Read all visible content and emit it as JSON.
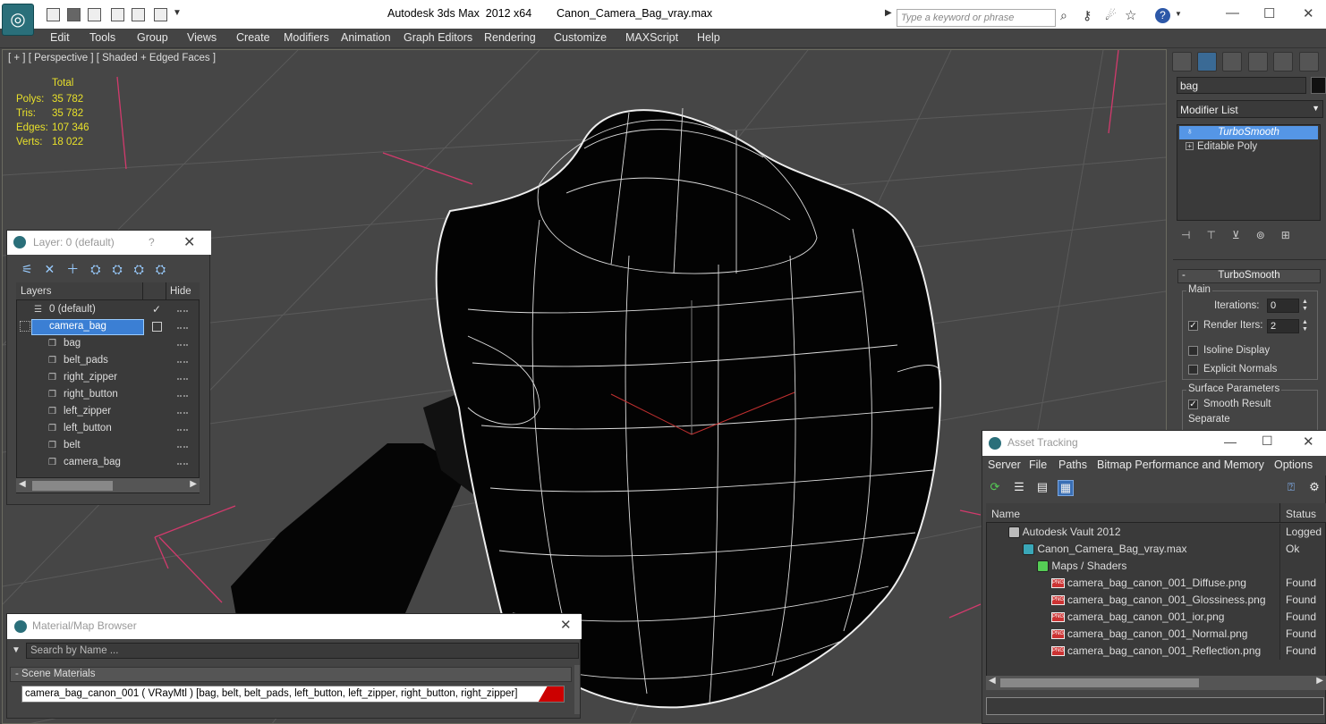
{
  "window": {
    "app_title": "Autodesk 3ds Max  2012 x64",
    "file_name": "Canon_Camera_Bag_vray.max",
    "search_placeholder": "Type a keyword or phrase"
  },
  "menu": [
    "Edit",
    "Tools",
    "Group",
    "Views",
    "Create",
    "Modifiers",
    "Animation",
    "Graph Editors",
    "Rendering",
    "Customize",
    "MAXScript",
    "Help"
  ],
  "viewport": {
    "label": "[ + ] [ Perspective ] [ Shaded + Edged Faces ]",
    "stats_header": "Total",
    "stats": [
      {
        "label": "Polys:",
        "value": "35 782"
      },
      {
        "label": "Tris:",
        "value": "35 782"
      },
      {
        "label": "Edges:",
        "value": "107 346"
      },
      {
        "label": "Verts:",
        "value": "18 022"
      }
    ]
  },
  "command_panel": {
    "object_name": "bag",
    "modifier_list": "Modifier List",
    "stack": [
      "TurboSmooth",
      "Editable Poly"
    ],
    "rollout_title": "TurboSmooth",
    "main_group": "Main",
    "iterations_label": "Iterations:",
    "iterations_value": "0",
    "render_iters_label": "Render Iters:",
    "render_iters_value": "2",
    "isoline_label": "Isoline Display",
    "explicit_normals_label": "Explicit Normals",
    "surface_group": "Surface Parameters",
    "smooth_result_label": "Smooth Result",
    "separate_label": "Separate"
  },
  "layer_panel": {
    "title": "Layer: 0 (default)",
    "help": "?",
    "col_layers": "Layers",
    "col_hide": "Hide",
    "layers": [
      {
        "name": "0 (default)",
        "level": 0,
        "checked": true
      },
      {
        "name": "camera_bag",
        "level": 0,
        "selected": true
      },
      {
        "name": "bag",
        "level": 1
      },
      {
        "name": "belt_pads",
        "level": 1
      },
      {
        "name": "right_zipper",
        "level": 1
      },
      {
        "name": "right_button",
        "level": 1
      },
      {
        "name": "left_zipper",
        "level": 1
      },
      {
        "name": "left_button",
        "level": 1
      },
      {
        "name": "belt",
        "level": 1
      },
      {
        "name": "camera_bag",
        "level": 1
      }
    ]
  },
  "asset_panel": {
    "title": "Asset Tracking",
    "menu": [
      "Server",
      "File",
      "Paths",
      "Bitmap Performance and Memory",
      "Options"
    ],
    "col_name": "Name",
    "col_status": "Status",
    "rows": [
      {
        "name": "Autodesk Vault 2012",
        "status": "Logged",
        "indent": 1,
        "icon": "vault"
      },
      {
        "name": "Canon_Camera_Bag_vray.max",
        "status": "Ok",
        "indent": 2,
        "icon": "max"
      },
      {
        "name": "Maps / Shaders",
        "status": "",
        "indent": 3,
        "icon": "maps"
      },
      {
        "name": "camera_bag_canon_001_Diffuse.png",
        "status": "Found",
        "indent": 4,
        "icon": "png"
      },
      {
        "name": "camera_bag_canon_001_Glossiness.png",
        "status": "Found",
        "indent": 4,
        "icon": "png"
      },
      {
        "name": "camera_bag_canon_001_ior.png",
        "status": "Found",
        "indent": 4,
        "icon": "png"
      },
      {
        "name": "camera_bag_canon_001_Normal.png",
        "status": "Found",
        "indent": 4,
        "icon": "png"
      },
      {
        "name": "camera_bag_canon_001_Reflection.png",
        "status": "Found",
        "indent": 4,
        "icon": "png"
      }
    ]
  },
  "material_panel": {
    "title": "Material/Map Browser",
    "search_placeholder": "Search by Name ...",
    "section": "- Scene Materials",
    "material": "camera_bag_canon_001  ( VRayMtl ) [bag, belt, belt_pads, left_button, left_zipper, right_button, right_zipper]"
  }
}
